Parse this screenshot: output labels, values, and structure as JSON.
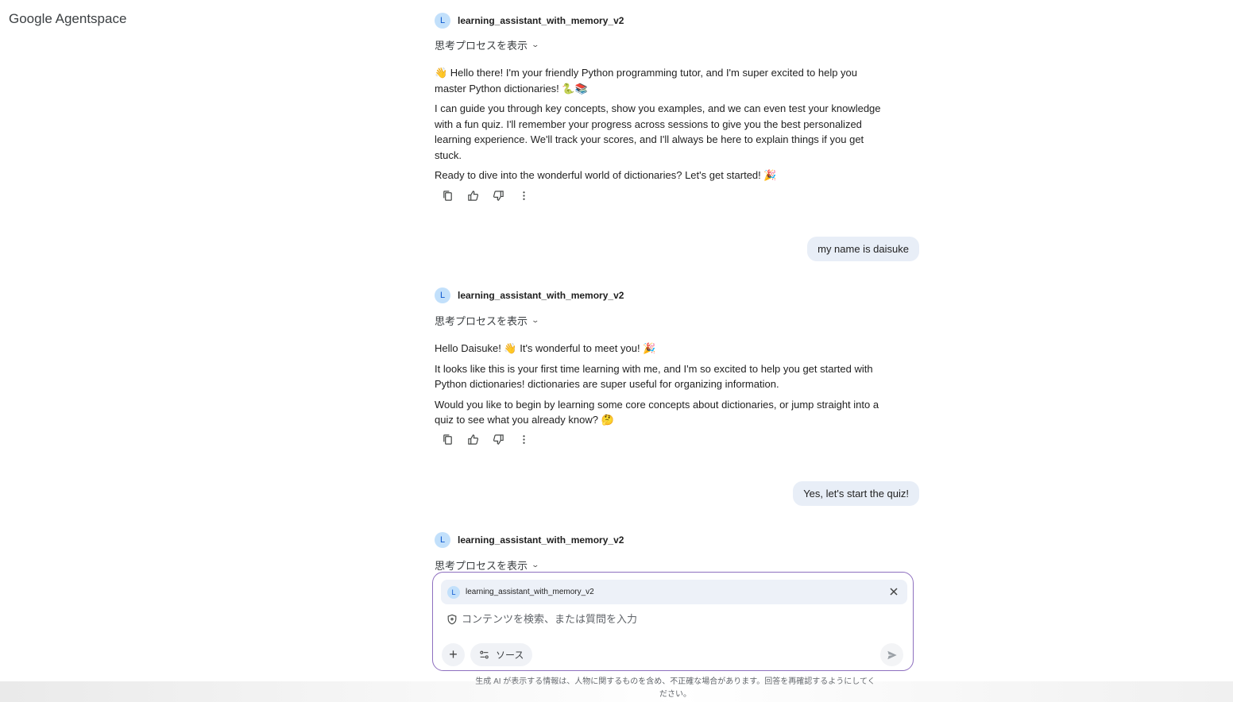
{
  "app": {
    "brand_google": "Google",
    "brand_product": "Agentspace"
  },
  "agent_name": "learning_assistant_with_memory_v2",
  "agent_initial": "L",
  "thinking_label": "思考プロセスを表示",
  "conversation": {
    "m1": {
      "p1": "👋 Hello there! I'm your friendly Python programming tutor, and I'm super excited to help you master Python dictionaries! 🐍📚",
      "p2": "I can guide you through key concepts, show you examples, and we can even test your knowledge with a fun quiz. I'll remember your progress across sessions to give you the best personalized learning experience. We'll track your scores, and I'll always be here to explain things if you get stuck.",
      "p3": "Ready to dive into the wonderful world of dictionaries? Let's get started! 🎉"
    },
    "user1": "my name is daisuke",
    "m2": {
      "p1": "Hello Daisuke! 👋 It's wonderful to meet you! 🎉",
      "p2": "It looks like this is your first time learning with me, and I'm so excited to help you get started with Python dictionaries! dictionaries are super useful for organizing information.",
      "p3": "Would you like to begin by learning some core concepts about dictionaries, or jump straight into a quiz to see what you already know? 🤔"
    },
    "user2": "Yes, let's start the quiz!"
  },
  "icons": {
    "copy": "copy-icon",
    "thumb_up": "thumb-up-icon",
    "thumb_down": "thumb-down-icon",
    "more": "more-vert-icon",
    "shield": "shield-icon",
    "close": "close-icon",
    "plus": "plus-icon",
    "tune": "tune-icon",
    "send": "send-icon"
  },
  "composer": {
    "chip_name": "learning_assistant_with_memory_v2",
    "placeholder": "コンテンツを検索、または質問を入力",
    "plus_label": "+",
    "source_label": "ソース"
  },
  "disclaimer": "生成 AI が表示する情報は、人物に関するものを含め、不正確な場合があります。回答を再確認するようにしてください。",
  "colors": {
    "accent_border": "#8e6fbf",
    "avatar_bg": "#c2e0fb",
    "user_bubble": "#e8eef7"
  }
}
